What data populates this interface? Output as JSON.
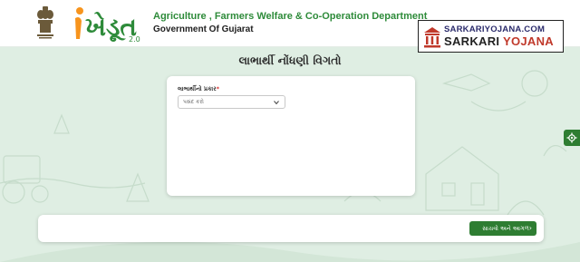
{
  "header": {
    "department": "Agriculture , Farmers Welfare & Co-Operation Department",
    "government": "Government Of Gujarat",
    "logo_text": "ખેડૂત",
    "logo_version": "2.0",
    "emblem_icon": "ashoka-emblem-icon"
  },
  "watermark": {
    "top": "SARKARIYOJANA.COM",
    "bottom_part1": "SARKARI",
    "bottom_part2": "YOJANA"
  },
  "page": {
    "title": "લાભાર્થી નોંધણી વિગતો"
  },
  "form": {
    "beneficiary_type_label": "લાભાર્થીનો પ્રકાર",
    "required_mark": "*",
    "select_placeholder": "પસંદ કરો"
  },
  "footer": {
    "next_button_label": "સાચવો અને આગળ",
    "next_arrow": "›"
  },
  "colors": {
    "brand_green": "#2e7d32",
    "dept_green": "#2e8b3a",
    "background": "#dfeee3"
  },
  "side": {
    "settings_icon": "gear-icon"
  }
}
